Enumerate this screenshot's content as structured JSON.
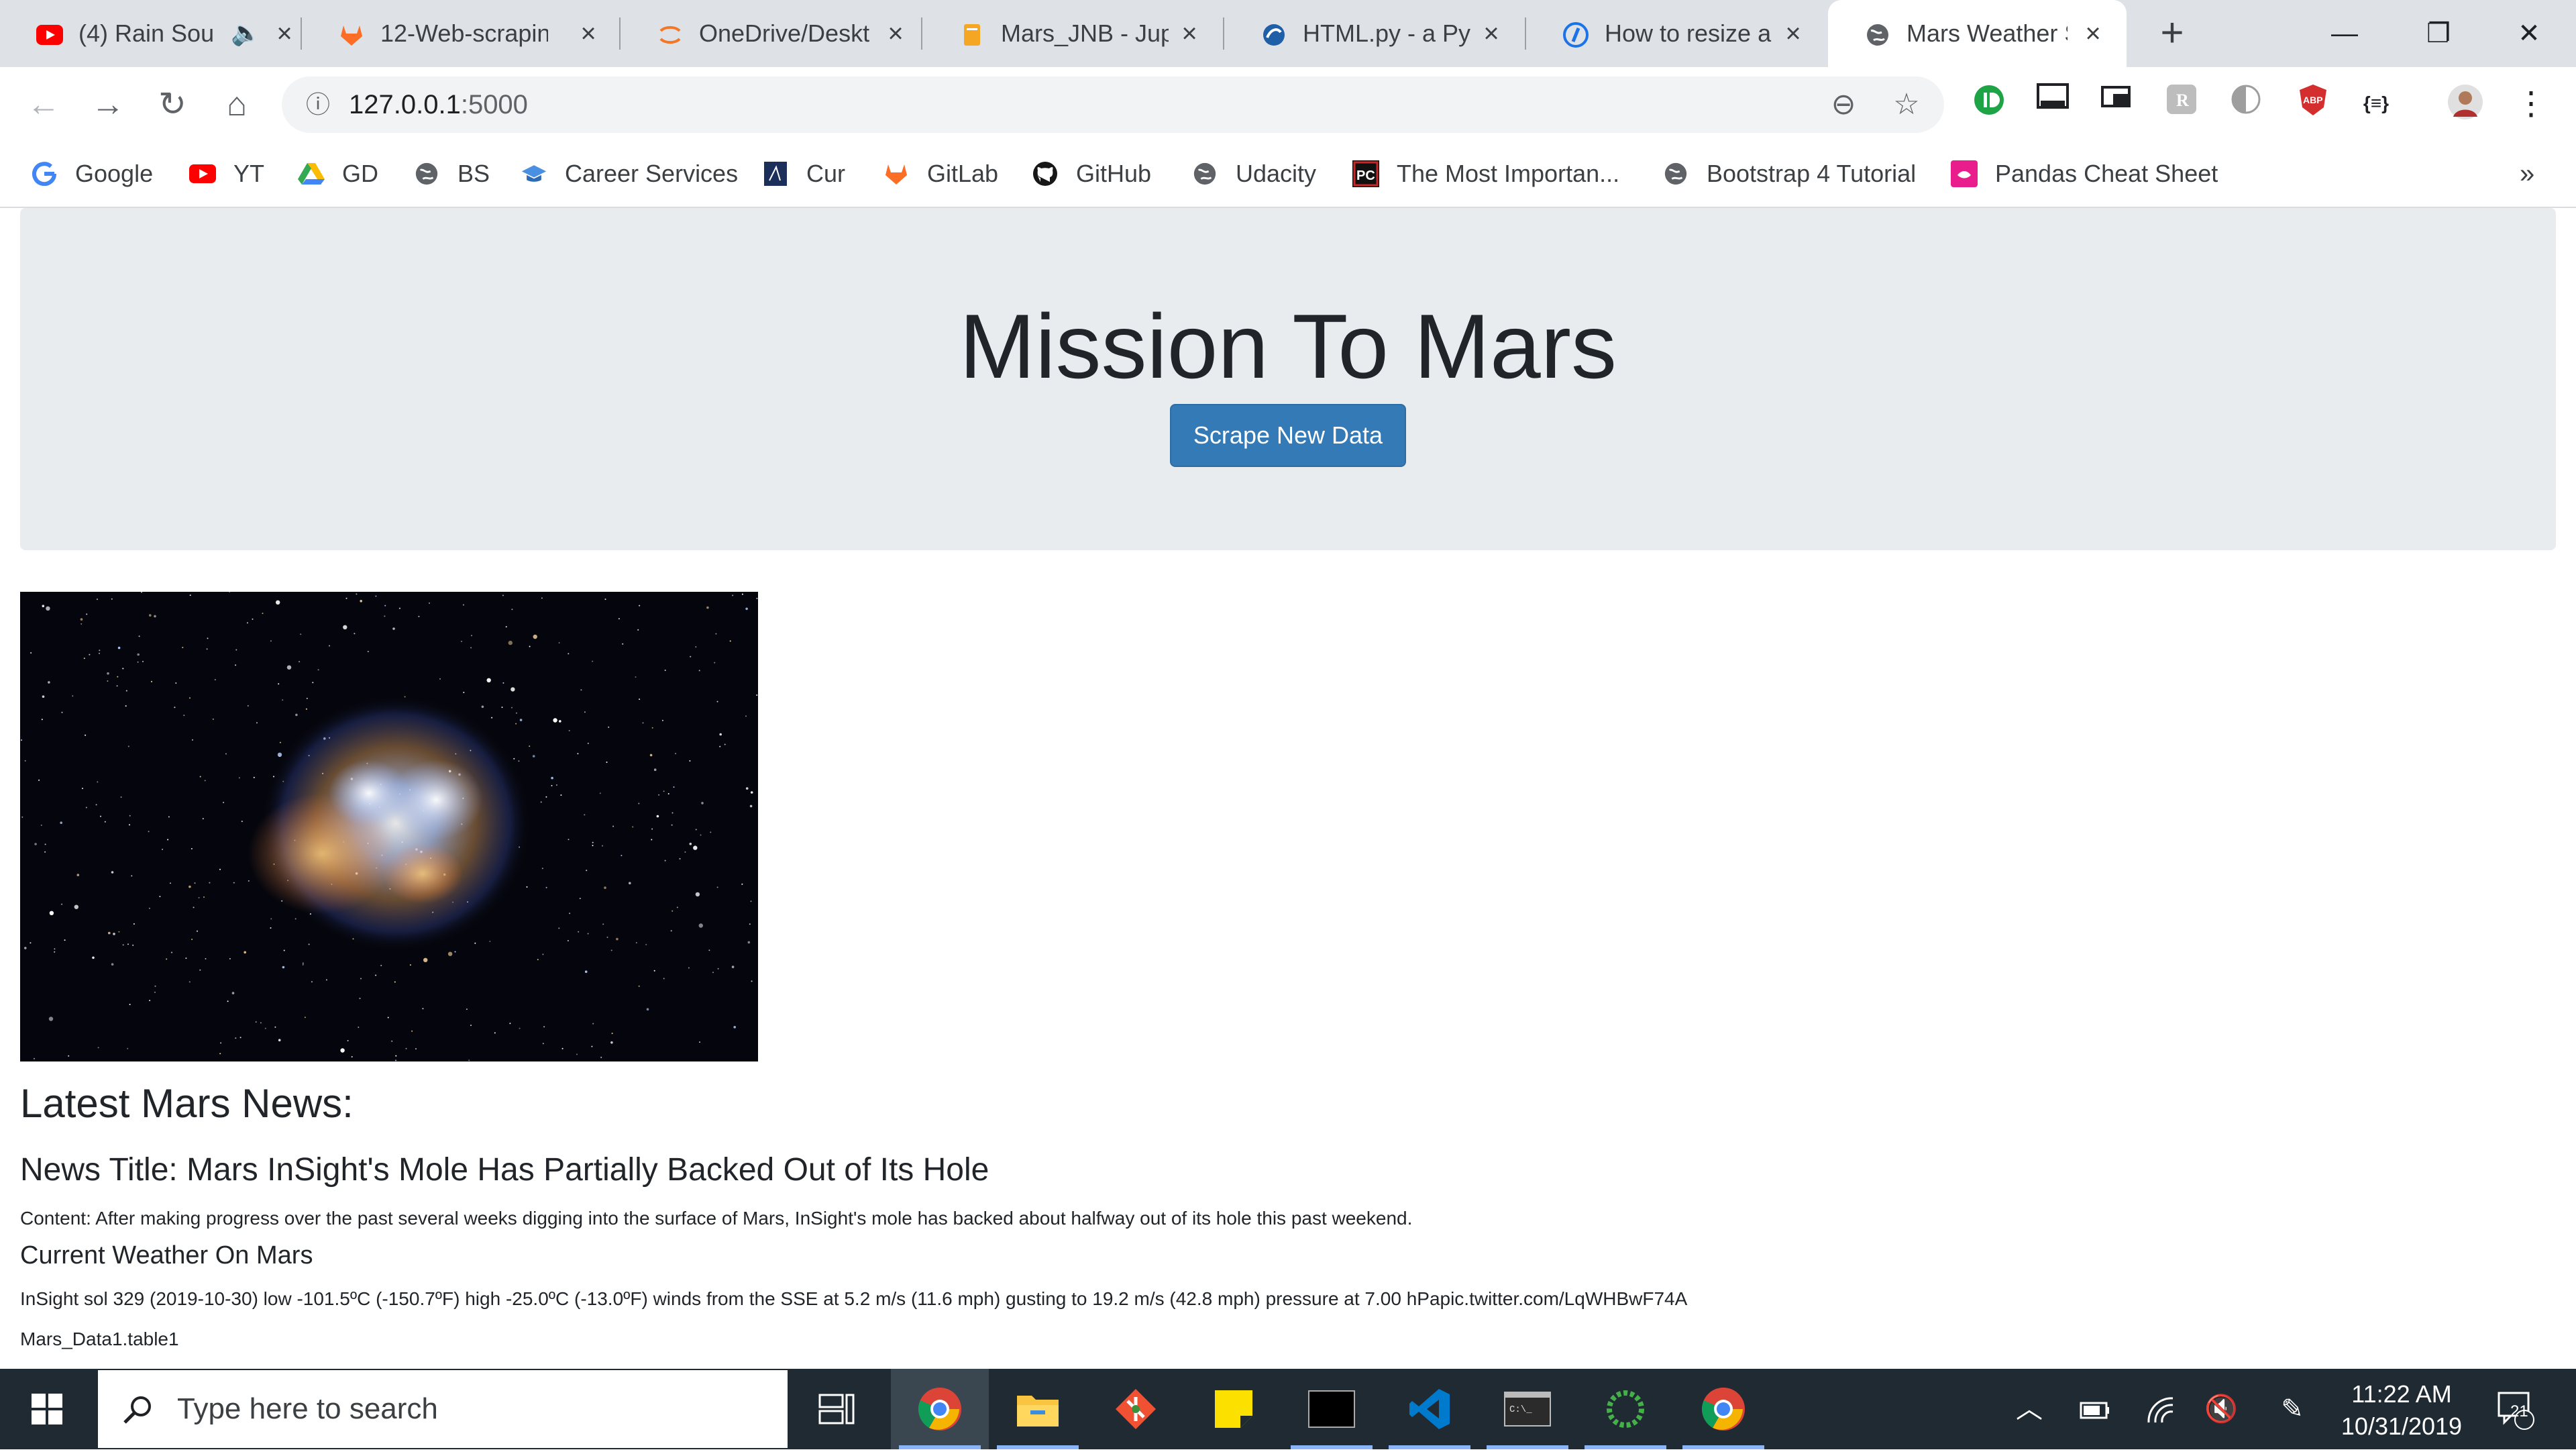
{
  "tabs": [
    {
      "title": "(4) Rain Sou",
      "icon": "youtube-icon"
    },
    {
      "title": "12-Web-scrapin",
      "icon": "gitlab-icon"
    },
    {
      "title": "OneDrive/Deskt",
      "icon": "jupyter-icon"
    },
    {
      "title": "Mars_JNB - Jupy",
      "icon": "notebook-icon"
    },
    {
      "title": "HTML.py - a Pyt",
      "icon": "python-icon"
    },
    {
      "title": "How to resize a",
      "icon": "how-to-icon"
    },
    {
      "title": "Mars Weather S",
      "icon": "globe-icon"
    }
  ],
  "address_bar": {
    "host": "127.0.0.1",
    "port": ":5000"
  },
  "bookmarks": [
    {
      "label": "Google",
      "icon": "google-icon"
    },
    {
      "label": "YT",
      "icon": "youtube-icon"
    },
    {
      "label": "GD",
      "icon": "drive-icon"
    },
    {
      "label": "BS",
      "icon": "globe-icon"
    },
    {
      "label": "Career Services",
      "icon": "graduation-cap-icon"
    },
    {
      "label": "Cur",
      "icon": "book-icon"
    },
    {
      "label": "GitLab",
      "icon": "gitlab-icon"
    },
    {
      "label": "GitHub",
      "icon": "github-icon"
    },
    {
      "label": "Udacity",
      "icon": "globe-icon"
    },
    {
      "label": "The Most Importan...",
      "icon": "pc-icon"
    },
    {
      "label": "Bootstrap 4 Tutorial",
      "icon": "globe-icon"
    },
    {
      "label": "Pandas Cheat Sheet",
      "icon": "pandas-icon"
    }
  ],
  "page": {
    "title": "Mission To Mars",
    "scrape_button": "Scrape New Data",
    "news_heading": "Latest Mars News:",
    "news_title": "News Title: Mars InSight's Mole Has Partially Backed Out of Its Hole",
    "news_content": "Content: After making progress over the past several weeks digging into the surface of Mars, InSight's mole has backed about halfway out of its hole this past weekend.",
    "weather_heading": "Current Weather On Mars",
    "weather_text": "InSight sol 329 (2019-10-30) low -101.5ºC (-150.7ºF) high -25.0ºC (-13.0ºF) winds from the SSE at 5.2 m/s (11.6 mph) gusting to 19.2 m/s (42.8 mph) pressure at 7.00 hPapic.twitter.com/LqWHBwF74A",
    "table_label": "Mars_Data1.table1"
  },
  "taskbar": {
    "search_placeholder": "Type here to search",
    "time": "11:22 AM",
    "date": "10/31/2019",
    "notification_count": "21",
    "apps": [
      "chrome-icon",
      "file-explorer-icon",
      "git-icon",
      "sticky-notes-icon",
      "terminal-icon",
      "vscode-icon",
      "cmd-icon",
      "anaconda-icon",
      "chrome-icon"
    ]
  },
  "colors": {
    "button_primary": "#337ab7",
    "jumbotron_bg": "#e9ecef",
    "taskbar_bg": "#1f2a33",
    "tabstrip_bg": "#dee1e6"
  }
}
